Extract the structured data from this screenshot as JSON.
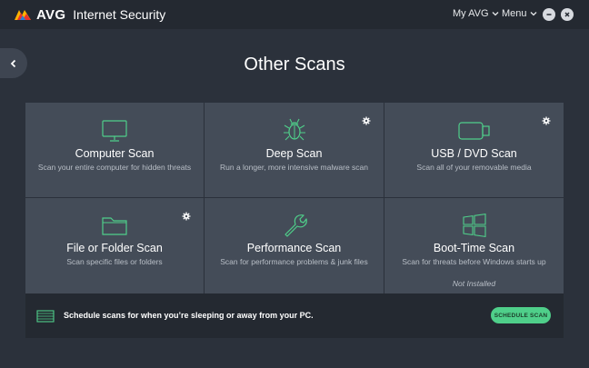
{
  "app": {
    "logo_text": "AVG",
    "product_name": "Internet Security",
    "nav": {
      "my_avg": "My AVG",
      "menu": "Menu"
    }
  },
  "page": {
    "title": "Other Scans"
  },
  "tiles": [
    {
      "name": "Computer Scan",
      "desc": "Scan your entire computer for hidden threats",
      "icon": "monitor-icon",
      "settings": false,
      "note": ""
    },
    {
      "name": "Deep Scan",
      "desc": "Run a longer, more intensive malware scan",
      "icon": "bug-icon",
      "settings": true,
      "note": ""
    },
    {
      "name": "USB / DVD Scan",
      "desc": "Scan all of your removable media",
      "icon": "usb-drive-icon",
      "settings": true,
      "note": ""
    },
    {
      "name": "File or Folder Scan",
      "desc": "Scan specific files or folders",
      "icon": "folder-icon",
      "settings": true,
      "note": ""
    },
    {
      "name": "Performance Scan",
      "desc": "Scan for performance problems & junk files",
      "icon": "wrench-icon",
      "settings": false,
      "note": ""
    },
    {
      "name": "Boot-Time Scan",
      "desc": "Scan for threats before Windows starts up",
      "icon": "windows-logo-icon",
      "settings": false,
      "note": "Not Installed"
    }
  ],
  "footer": {
    "text": "Schedule scans for when you’re sleeping or away from your PC.",
    "button": "SCHEDULE SCAN"
  },
  "colors": {
    "accent": "#4fcf8a",
    "background": "#2b313b",
    "tile": "#444c58",
    "titlebar": "#242931"
  }
}
